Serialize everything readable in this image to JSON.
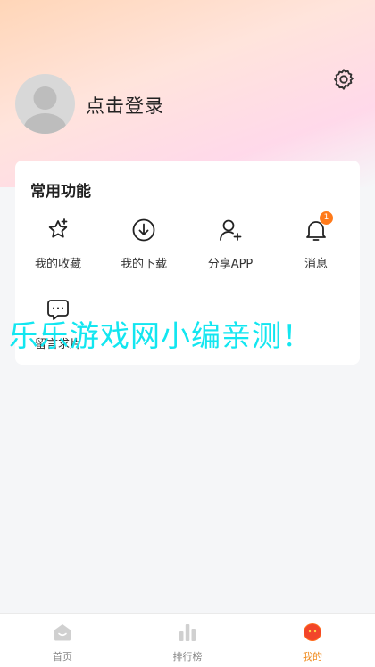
{
  "header": {
    "login_text": "点击登录",
    "settings_icon": "gear-icon",
    "avatar_icon": "default-avatar-icon"
  },
  "functions": {
    "title": "常用功能",
    "items": [
      {
        "label": "我的收藏",
        "icon": "star-icon"
      },
      {
        "label": "我的下载",
        "icon": "download-icon"
      },
      {
        "label": "分享APP",
        "icon": "add-user-icon"
      },
      {
        "label": "消息",
        "icon": "bell-icon",
        "badge": "1"
      },
      {
        "label": "留言求片",
        "icon": "message-icon"
      }
    ]
  },
  "watermark": "乐乐游戏网小编亲测！",
  "tabbar": {
    "tabs": [
      {
        "label": "首页",
        "icon": "home-icon"
      },
      {
        "label": "排行榜",
        "icon": "ranking-icon"
      },
      {
        "label": "我的",
        "icon": "profile-icon",
        "active": true
      }
    ]
  },
  "colors": {
    "accent": "#f08a1c",
    "badge": "#ff7a1a",
    "watermark": "#12e6f0"
  }
}
